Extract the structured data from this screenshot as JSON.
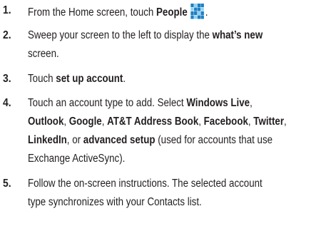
{
  "steps": [
    {
      "number": "1.",
      "lines": [
        [
          {
            "text": "From the Home screen, touch ",
            "bold": false
          },
          {
            "text": "People",
            "bold": true
          },
          {
            "text": "",
            "icon": "people-tile-icon"
          },
          {
            "text": ".",
            "bold": false
          }
        ]
      ]
    },
    {
      "number": "2.",
      "lines": [
        [
          {
            "text": "Sweep your screen to the left to display the ",
            "bold": false
          },
          {
            "text": "what’s new",
            "bold": true
          }
        ],
        [
          {
            "text": "screen.",
            "bold": false
          }
        ]
      ]
    },
    {
      "number": "3.",
      "lines": [
        [
          {
            "text": "Touch ",
            "bold": false
          },
          {
            "text": "set up account",
            "bold": true
          },
          {
            "text": ".",
            "bold": false
          }
        ]
      ]
    },
    {
      "number": "4.",
      "lines": [
        [
          {
            "text": "Touch an account type to add. Select ",
            "bold": false
          },
          {
            "text": "Windows Live",
            "bold": true
          },
          {
            "text": ",",
            "bold": false
          }
        ],
        [
          {
            "text": "Outlook",
            "bold": true
          },
          {
            "text": ", ",
            "bold": false
          },
          {
            "text": "Google",
            "bold": true
          },
          {
            "text": ", ",
            "bold": false
          },
          {
            "text": "AT&T Address Book",
            "bold": true
          },
          {
            "text": ", ",
            "bold": false
          },
          {
            "text": "Facebook",
            "bold": true
          },
          {
            "text": ", ",
            "bold": false
          },
          {
            "text": "Twitter",
            "bold": true
          },
          {
            "text": ",",
            "bold": false
          }
        ],
        [
          {
            "text": "LinkedIn",
            "bold": true
          },
          {
            "text": ", or ",
            "bold": false
          },
          {
            "text": "advanced setup",
            "bold": true
          },
          {
            "text": " (used for accounts that use",
            "bold": false
          }
        ],
        [
          {
            "text": "Exchange ActiveSync).",
            "bold": false
          }
        ]
      ]
    },
    {
      "number": "5.",
      "lines": [
        [
          {
            "text": "Follow the on-screen instructions. The selected account",
            "bold": false
          }
        ],
        [
          {
            "text": "type synchronizes with your Contacts list.",
            "bold": false
          }
        ]
      ]
    }
  ],
  "colors": {
    "text": "#231f20",
    "icon_tile_dark": "#1f7fc1",
    "icon_tile_light": "#8fd3f5"
  }
}
